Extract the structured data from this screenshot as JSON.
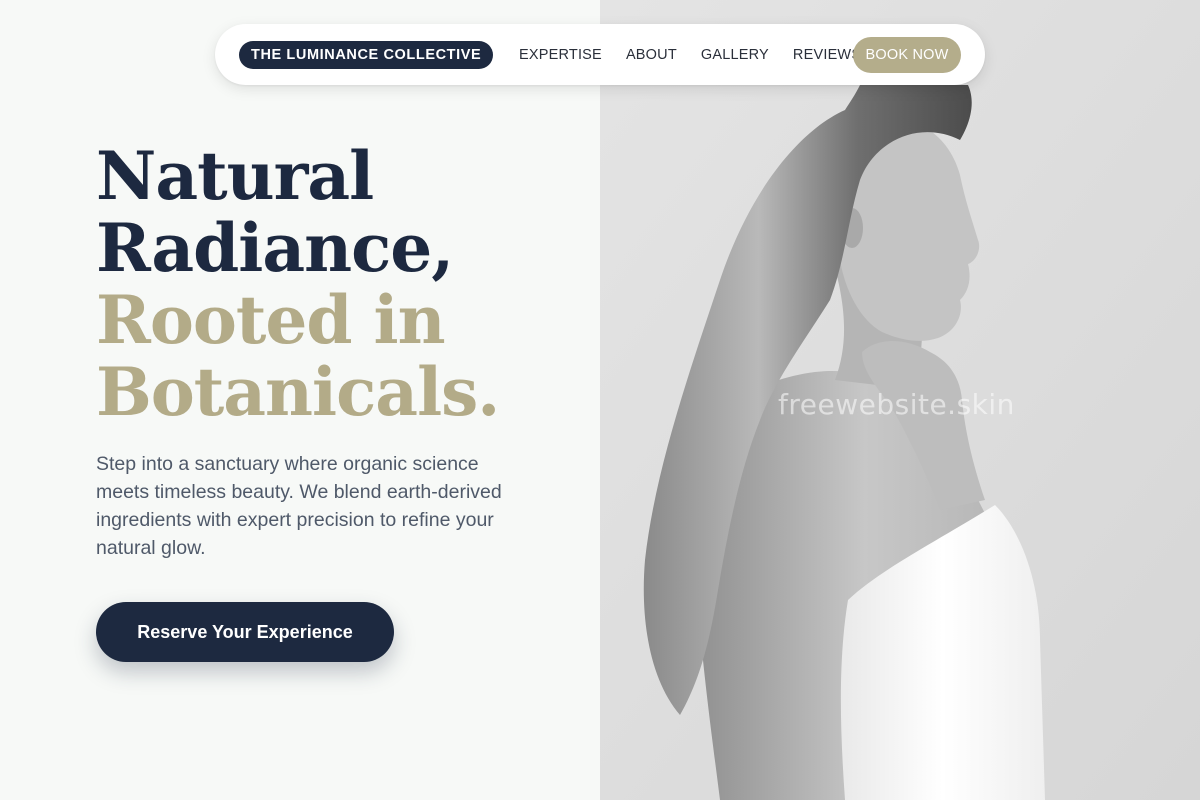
{
  "nav": {
    "brand": "THE LUMINANCE COLLECTIVE",
    "links": [
      "EXPERTISE",
      "ABOUT",
      "GALLERY",
      "REVIEWS"
    ],
    "book_label": "BOOK NOW"
  },
  "hero": {
    "headline_dark": [
      "Natural",
      "Radiance,"
    ],
    "headline_accent": [
      "Rooted in",
      "Botanicals."
    ],
    "subtext": "Step into a sanctuary where organic science meets timeless beauty. We blend earth-derived ingredients with expert precision to refine your natural glow.",
    "cta_label": "Reserve Your Experience"
  },
  "watermark": "freewebsite.skin",
  "colors": {
    "navy": "#1d2940",
    "gold": "#b3ab88",
    "button_gold": "#b4ad8b",
    "left_background": "#f7f9f7",
    "body_text": "#4f5969"
  }
}
